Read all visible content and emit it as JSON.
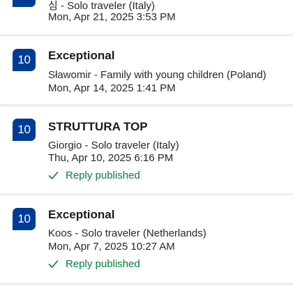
{
  "reviews": [
    {
      "score": "",
      "title": "",
      "reviewer": "심 - Solo traveler (Italy)",
      "date": "Mon, Apr 21, 2025 3:53 PM",
      "reply": ""
    },
    {
      "score": "10",
      "title": "Exceptional",
      "reviewer": "Sławomir - Family with young children (Poland)",
      "date": "Mon, Apr 14, 2025 1:41 PM",
      "reply": ""
    },
    {
      "score": "10",
      "title": "STRUTTURA TOP",
      "reviewer": "Giorgio - Solo traveler (Italy)",
      "date": "Thu, Apr 10, 2025 6:16 PM",
      "reply": "Reply published"
    },
    {
      "score": "10",
      "title": "Exceptional",
      "reviewer": "Koos - Solo traveler (Netherlands)",
      "date": "Mon, Apr 7, 2025 10:27 AM",
      "reply": "Reply published"
    }
  ],
  "icons": {
    "reply_check": "check-icon"
  },
  "colors": {
    "score_badge": "#003b95",
    "reply_status": "#00803c",
    "card_bg": "#ffffff",
    "divider_bg": "#eeeef0"
  }
}
